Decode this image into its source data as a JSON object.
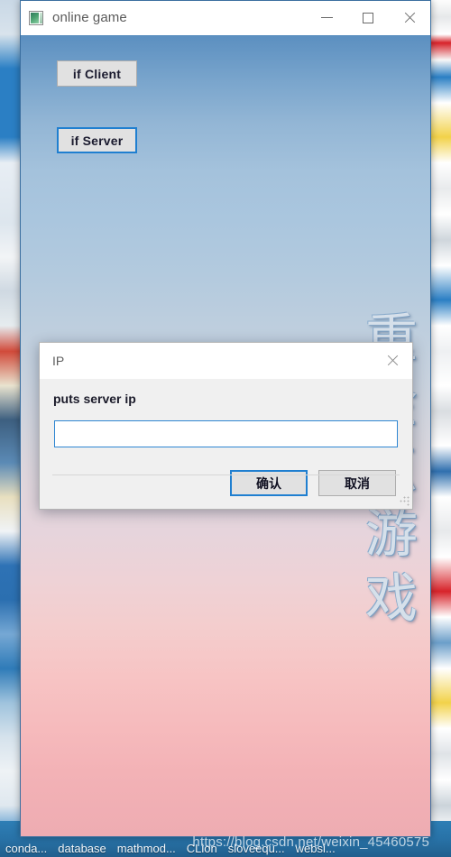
{
  "window": {
    "title": "online game",
    "icon": "app-window-icon",
    "controls": {
      "minimize": "—",
      "maximize": "□",
      "close": "✕"
    },
    "buttons": [
      {
        "id": "btn-client",
        "label": "if Client",
        "state": "normal"
      },
      {
        "id": "btn-server",
        "label": "if Server",
        "state": "focused"
      }
    ]
  },
  "dialog": {
    "title": "IP",
    "close_icon": "close-icon",
    "prompt": "puts server ip",
    "input": {
      "value": "",
      "placeholder": ""
    },
    "confirm_label": "确认",
    "cancel_label": "取消",
    "resize_grip": "resize-grip"
  },
  "wallpaper": {
    "vertical_text": [
      "重",
      "金",
      "点",
      "游",
      "戏"
    ]
  },
  "taskbar": {
    "items": [
      "conda...",
      "database",
      "mathmod...",
      "CLion",
      "sloveequ...",
      "websi..."
    ]
  },
  "watermark": "https://blog.csdn.net/weixin_45460575",
  "colors": {
    "accent_focus": "#1f7fd0",
    "button_face": "#e1e1e1",
    "dialog_face": "#f0f0f0",
    "titlebar": "#ffffff",
    "taskbar": "#2872a7",
    "sky_top": "#5b8fc0",
    "sky_bottom": "#eeacb2"
  }
}
